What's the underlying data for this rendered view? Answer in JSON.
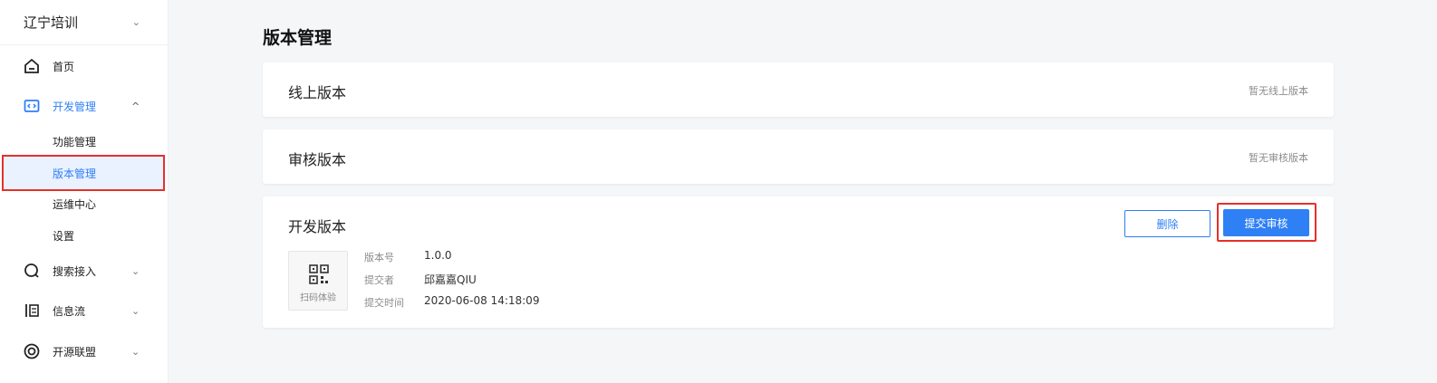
{
  "sidebar": {
    "app_name": "辽宁培训",
    "items": [
      {
        "label": "首页"
      },
      {
        "label": "开发管理"
      },
      {
        "label": "搜索接入"
      },
      {
        "label": "信息流"
      },
      {
        "label": "开源联盟"
      }
    ],
    "sub_items": [
      {
        "label": "功能管理"
      },
      {
        "label": "版本管理"
      },
      {
        "label": "运维中心"
      },
      {
        "label": "设置"
      }
    ]
  },
  "page": {
    "title": "版本管理"
  },
  "online_version": {
    "title": "线上版本",
    "note": "暂无线上版本"
  },
  "review_version": {
    "title": "审核版本",
    "note": "暂无审核版本"
  },
  "dev_version": {
    "title": "开发版本",
    "delete_label": "删除",
    "submit_label": "提交审核",
    "qr_label": "扫码体验",
    "version_label": "版本号",
    "version_value": "1.0.0",
    "submitter_label": "提交者",
    "submitter_value": "邱嘉嘉QIU",
    "time_label": "提交时间",
    "time_value": "2020-06-08 14:18:09"
  },
  "colors": {
    "accent": "#2f7ff5",
    "highlight": "#e5302b",
    "background": "#f5f6f8"
  }
}
